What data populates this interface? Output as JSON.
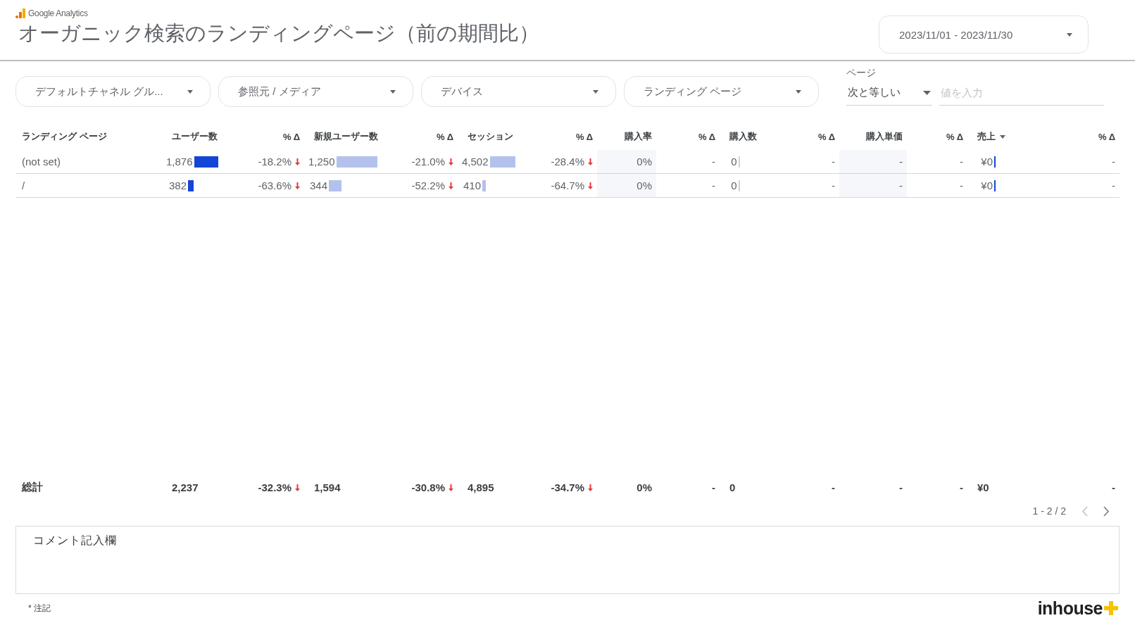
{
  "header": {
    "brand": "Google Analytics",
    "title": "オーガニック検索のランディングページ（前の期間比）",
    "date_range": "2023/11/01 - 2023/11/30"
  },
  "filters": [
    {
      "label": "デフォルトチャネル グル..."
    },
    {
      "label": "参照元 / メディア"
    },
    {
      "label": "デバイス"
    },
    {
      "label": "ランディング ページ"
    }
  ],
  "page_filter": {
    "label": "ページ",
    "operator": "次と等しい",
    "placeholder": "値を入力"
  },
  "table": {
    "columns": [
      {
        "label": "ランディング ページ",
        "kind": "text",
        "sorted": false
      },
      {
        "label": "ユーザー数",
        "kind": "bar",
        "color": "#1445d6",
        "sorted": false
      },
      {
        "label": "% Δ",
        "kind": "delta",
        "sorted": false
      },
      {
        "label": "新規ユーザー数",
        "kind": "bar",
        "color": "#b4c1ec",
        "sorted": false
      },
      {
        "label": "% Δ",
        "kind": "delta",
        "sorted": false
      },
      {
        "label": "セッション",
        "kind": "bar",
        "color": "#b4c1ec",
        "sorted": false
      },
      {
        "label": "% Δ",
        "kind": "delta",
        "sorted": false
      },
      {
        "label": "購入率",
        "kind": "heat",
        "sorted": false
      },
      {
        "label": "% Δ",
        "kind": "delta",
        "sorted": false
      },
      {
        "label": "購入数",
        "kind": "bar",
        "color": "#cfd3dc",
        "sorted": false
      },
      {
        "label": "% Δ",
        "kind": "delta",
        "sorted": false
      },
      {
        "label": "購入単価",
        "kind": "heat",
        "sorted": false
      },
      {
        "label": "% Δ",
        "kind": "delta",
        "sorted": false
      },
      {
        "label": "売上",
        "kind": "bar",
        "color": "#1445d6",
        "sorted": true
      },
      {
        "label": "% Δ",
        "kind": "delta",
        "sorted": false
      }
    ],
    "rows": [
      {
        "cells": [
          {
            "text": "(not set)"
          },
          {
            "text": "1,876",
            "level": 1
          },
          {
            "text": "-18.2%",
            "decreased": true
          },
          {
            "text": "1,250",
            "level": 1
          },
          {
            "text": "-21.0%",
            "decreased": true
          },
          {
            "text": "4,502",
            "level": 1
          },
          {
            "text": "-28.4%",
            "decreased": true
          },
          {
            "text": "0%"
          },
          {
            "text": "-",
            "decreased": false
          },
          {
            "text": "0",
            "level": 0
          },
          {
            "text": "-",
            "decreased": false
          },
          {
            "text": "-"
          },
          {
            "text": "-",
            "decreased": false
          },
          {
            "text": "¥0",
            "level": 0
          },
          {
            "text": "-",
            "decreased": false
          }
        ]
      },
      {
        "cells": [
          {
            "text": "/"
          },
          {
            "text": "382",
            "level": 0.2
          },
          {
            "text": "-63.6%",
            "decreased": true
          },
          {
            "text": "344",
            "level": 0.28
          },
          {
            "text": "-52.2%",
            "decreased": true
          },
          {
            "text": "410",
            "level": 0.09
          },
          {
            "text": "-64.7%",
            "decreased": true
          },
          {
            "text": "0%"
          },
          {
            "text": "-",
            "decreased": false
          },
          {
            "text": "0",
            "level": 0
          },
          {
            "text": "-",
            "decreased": false
          },
          {
            "text": "-"
          },
          {
            "text": "-",
            "decreased": false
          },
          {
            "text": "¥0",
            "level": 0
          },
          {
            "text": "-",
            "decreased": false
          }
        ]
      }
    ],
    "totals": [
      {
        "text": "総計"
      },
      {
        "text": "2,237"
      },
      {
        "text": "-32.3%",
        "decreased": true
      },
      {
        "text": "1,594"
      },
      {
        "text": "-30.8%",
        "decreased": true
      },
      {
        "text": "4,895"
      },
      {
        "text": "-34.7%",
        "decreased": true
      },
      {
        "text": "0%"
      },
      {
        "text": "-",
        "decreased": false
      },
      {
        "text": "0"
      },
      {
        "text": "-",
        "decreased": false
      },
      {
        "text": "-"
      },
      {
        "text": "-",
        "decreased": false
      },
      {
        "text": "¥0"
      },
      {
        "text": "-",
        "decreased": false
      }
    ],
    "pagination": {
      "range": "1 - 2 / 2",
      "prev_disabled": true,
      "next_disabled": false
    }
  },
  "comment_box": {
    "title": "コメント記入欄"
  },
  "footer": {
    "note": "* 注記",
    "logo": "inhouse"
  }
}
